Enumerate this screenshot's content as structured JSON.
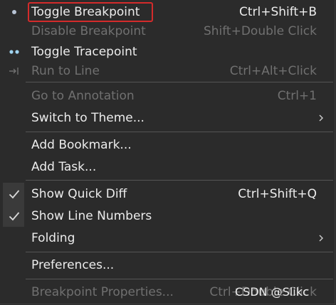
{
  "menu": {
    "items": [
      {
        "label": "Toggle Breakpoint",
        "accel": "Ctrl+Shift+B",
        "icon": "breakpoint-dot-icon"
      },
      {
        "label": "Disable Breakpoint",
        "accel": "Shift+Double Click"
      },
      {
        "label": "Toggle Tracepoint",
        "icon": "tracepoint-icon"
      },
      {
        "label": "Run to Line",
        "accel": "Ctrl+Alt+Click",
        "icon": "run-to-line-icon"
      },
      {
        "label": "Go to Annotation",
        "accel": "Ctrl+1"
      },
      {
        "label": "Switch to Theme..."
      },
      {
        "label": "Add Bookmark..."
      },
      {
        "label": "Add Task..."
      },
      {
        "label": "Show Quick Diff",
        "accel": "Ctrl+Shift+Q",
        "checked": true
      },
      {
        "label": "Show Line Numbers",
        "checked": true
      },
      {
        "label": "Folding"
      },
      {
        "label": "Preferences..."
      },
      {
        "label": "Breakpoint Properties...",
        "accel": "Ctrl+Double Click"
      }
    ]
  },
  "watermark": "CSDN @Slikc",
  "colors": {
    "background": "#2b2b2b",
    "text": "#ececec",
    "disabled_text": "#707070",
    "separator": "#555555",
    "highlight_border": "#d42b2b"
  }
}
